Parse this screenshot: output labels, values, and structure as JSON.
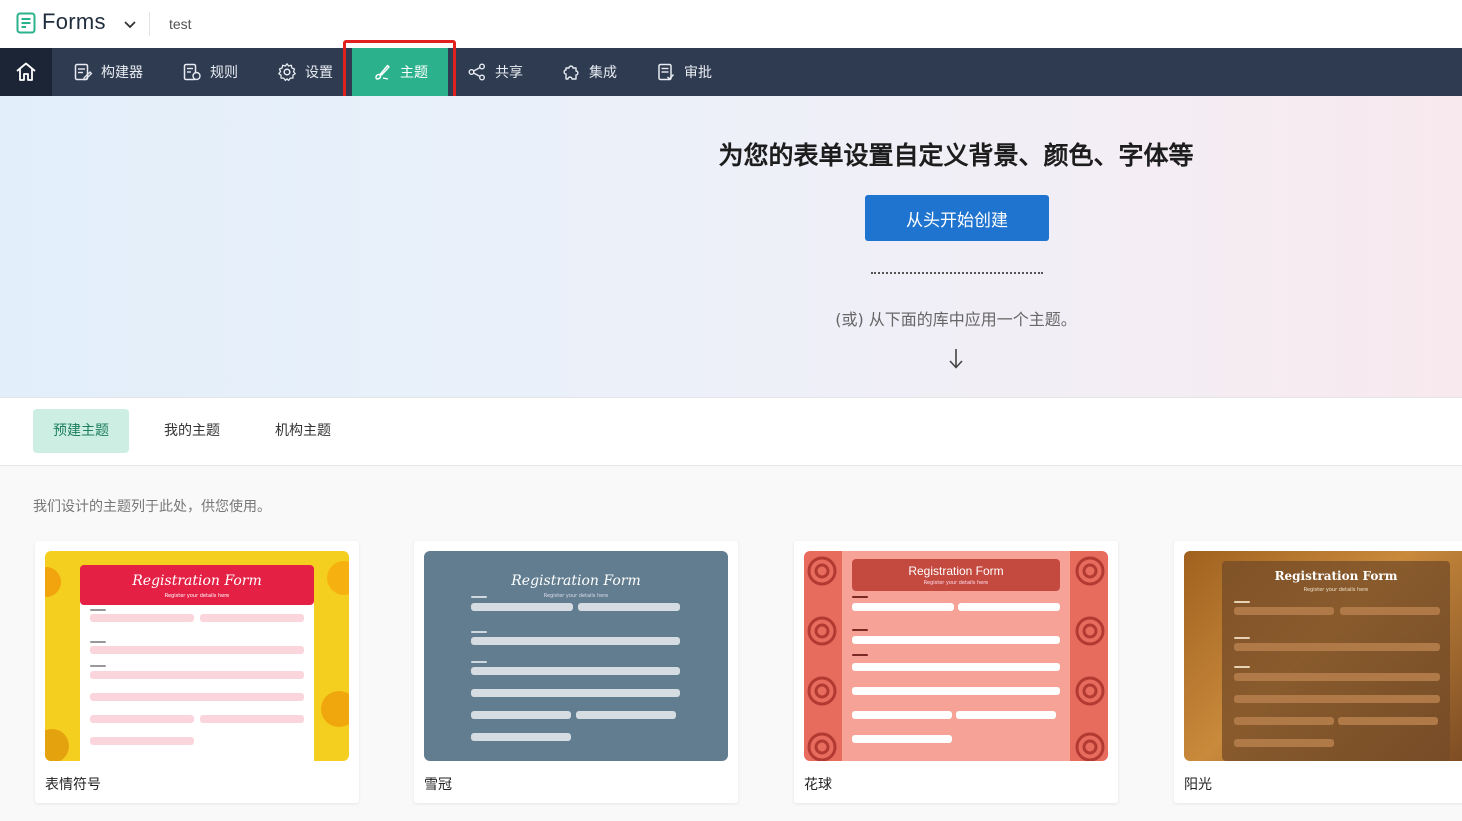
{
  "app": {
    "name": "Forms",
    "form_name": "test",
    "logo_icon": "forms-logo-icon"
  },
  "nav": {
    "home_icon": "home-icon",
    "items": [
      {
        "label": "构建器",
        "icon": "builder-icon"
      },
      {
        "label": "规则",
        "icon": "rules-icon"
      },
      {
        "label": "设置",
        "icon": "gear-icon"
      },
      {
        "label": "主题",
        "icon": "theme-brush-icon",
        "active": true
      },
      {
        "label": "共享",
        "icon": "share-icon"
      },
      {
        "label": "集成",
        "icon": "puzzle-icon"
      },
      {
        "label": "审批",
        "icon": "approval-icon"
      }
    ]
  },
  "hero": {
    "title": "为您的表单设置自定义背景、颜色、字体等",
    "create_button": "从头开始创建",
    "or_text": "(或) 从下面的库中应用一个主题。",
    "arrow_icon": "arrow-down-icon"
  },
  "tabs": [
    {
      "label": "预建主题",
      "active": true
    },
    {
      "label": "我的主题"
    },
    {
      "label": "机构主题"
    }
  ],
  "gallery": {
    "description": "我们设计的主题列于此处，供您使用。",
    "themes": [
      {
        "name": "表情符号",
        "preview_title": "Registration Form",
        "preview_subtitle": "Register your details here"
      },
      {
        "name": "雪冠",
        "preview_title": "Registration Form",
        "preview_subtitle": "Register your details here"
      },
      {
        "name": "花球",
        "preview_title": "Registration Form",
        "preview_subtitle": "Register your details here"
      },
      {
        "name": "阳光",
        "preview_title": "Registration Form",
        "preview_subtitle": "Register your details here"
      }
    ]
  },
  "colors": {
    "nav_bg": "#2f3b51",
    "nav_active": "#2bb18b",
    "primary_button": "#1f74d0",
    "highlight": "#e0211e",
    "tab_active_bg": "#cdeee2"
  }
}
